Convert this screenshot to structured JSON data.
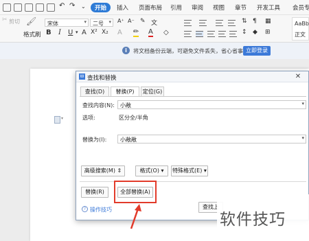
{
  "ribbon": {
    "tabs": [
      "开始",
      "插入",
      "页面布局",
      "引用",
      "审阅",
      "视图",
      "章节",
      "开发工具",
      "会员专"
    ],
    "active_tab": "开始"
  },
  "toolbar": {
    "cut_label": "剪切",
    "format_painter_label": "格式刷",
    "font_name": "宋体",
    "font_size": "二号",
    "style_preview": "AaBb",
    "style_name": "正文"
  },
  "notice": {
    "text": "将文档备份云端，可避免文件丢失，省心省事",
    "login_button": "立即登录"
  },
  "dialog": {
    "title": "查找和替换",
    "tabs": [
      "查找(D)",
      "替换(P)",
      "定位(G)"
    ],
    "active_tab": "替换(P)",
    "find_label": "查找内容(N):",
    "find_value": "小敞",
    "options_label": "选项:",
    "options_value": "区分全/半角",
    "replace_label": "替换为(I):",
    "replace_value": "小敞敞",
    "buttons": {
      "advanced": "高级搜索(M)",
      "format": "格式(O)",
      "special": "特殊格式(E)",
      "replace": "替换(R)",
      "replace_all": "全部替换(A)",
      "find_prev": "查找上"
    },
    "tips_link": "操作技巧"
  },
  "watermark": "软件技巧",
  "colors": {
    "accent": "#2e7bd6",
    "highlight": "#e23a2a"
  }
}
